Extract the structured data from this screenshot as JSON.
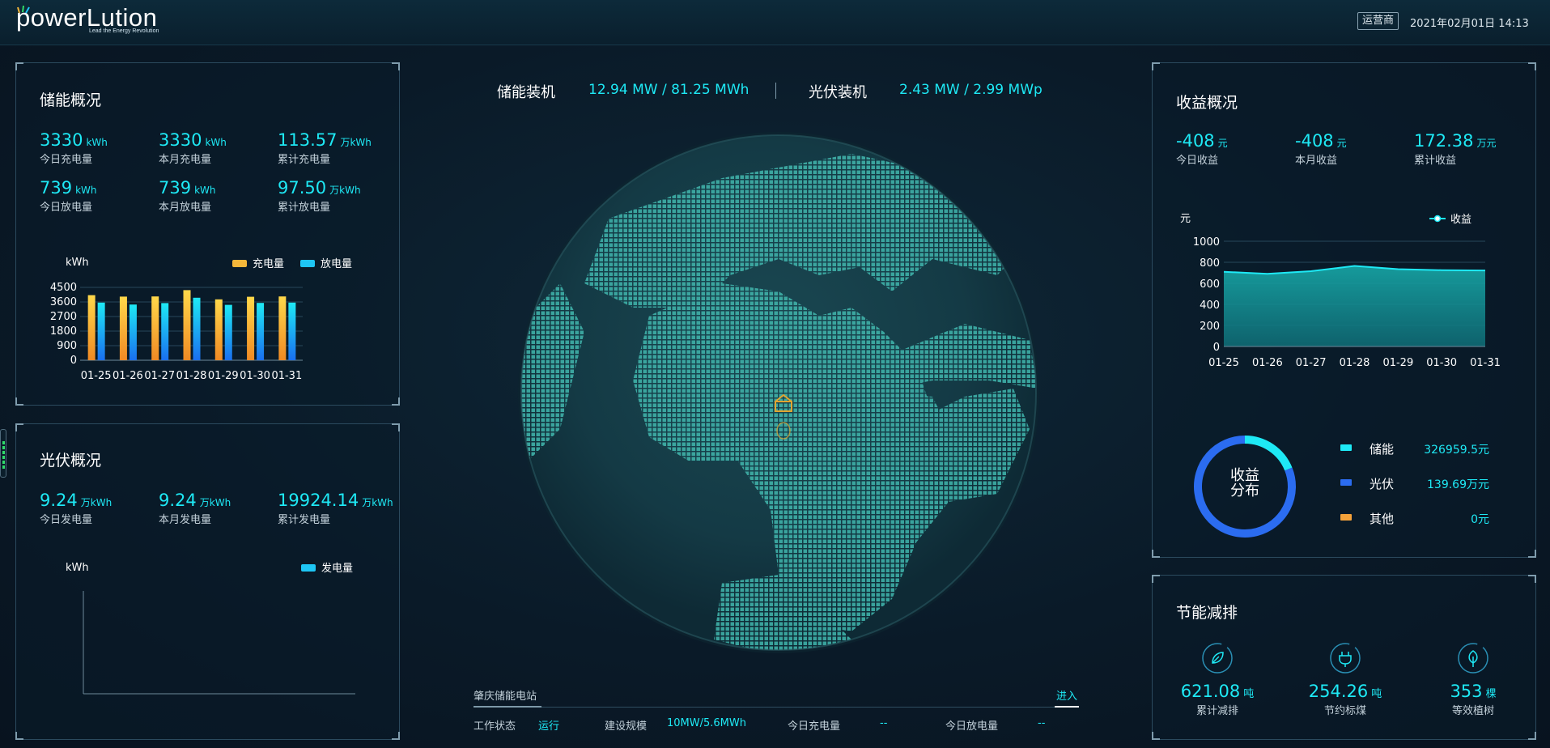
{
  "header": {
    "logo_text": "powerLution",
    "logo_tagline": "Lead the Energy Revolution",
    "role_badge": "运营商",
    "datetime": "2021年02月01日 14:13"
  },
  "storage_overview": {
    "title": "储能概况",
    "stats": [
      {
        "value": "3330",
        "unit": "kWh",
        "label": "今日充电量"
      },
      {
        "value": "3330",
        "unit": "kWh",
        "label": "本月充电量"
      },
      {
        "value": "113.57",
        "unit": "万kWh",
        "label": "累计充电量"
      },
      {
        "value": "739",
        "unit": "kWh",
        "label": "今日放电量"
      },
      {
        "value": "739",
        "unit": "kWh",
        "label": "本月放电量"
      },
      {
        "value": "97.50",
        "unit": "万kWh",
        "label": "累计放电量"
      }
    ]
  },
  "pv_overview": {
    "title": "光伏概况",
    "stats": [
      {
        "value": "9.24",
        "unit": "万kWh",
        "label": "今日发电量"
      },
      {
        "value": "9.24",
        "unit": "万kWh",
        "label": "本月发电量"
      },
      {
        "value": "19924.14",
        "unit": "万kWh",
        "label": "累计发电量"
      }
    ]
  },
  "center": {
    "storage_capacity_label": "储能装机",
    "storage_capacity_value": "12.94 MW / 81.25 MWh",
    "pv_capacity_label": "光伏装机",
    "pv_capacity_value": "2.43 MW / 2.99 MWp"
  },
  "station": {
    "name": "肇庆储能电站",
    "enter_label": "进入",
    "fields": [
      {
        "label": "工作状态",
        "value": "运行"
      },
      {
        "label": "建设规模",
        "value": "10MW/5.6MWh"
      },
      {
        "label": "今日充电量",
        "value": "--"
      },
      {
        "label": "今日放电量",
        "value": "--"
      }
    ]
  },
  "income_overview": {
    "title": "收益概况",
    "stats": [
      {
        "value": "-408",
        "unit": "元",
        "label": "今日收益"
      },
      {
        "value": "-408",
        "unit": "元",
        "label": "本月收益"
      },
      {
        "value": "172.38",
        "unit": "万元",
        "label": "累计收益"
      }
    ],
    "donut_label_line1": "收益",
    "donut_label_line2": "分布",
    "distribution": [
      {
        "name": "储能",
        "value": "326959.5元",
        "color": "#1ee9f5"
      },
      {
        "name": "光伏",
        "value": "139.69万元",
        "color": "#2b6cf0"
      },
      {
        "name": "其他",
        "value": "0元",
        "color": "#f5a23a"
      }
    ]
  },
  "energy_saving": {
    "title": "节能减排",
    "items": [
      {
        "icon": "leaf-icon",
        "value": "621.08",
        "unit": "吨",
        "label": "累计减排"
      },
      {
        "icon": "plug-icon",
        "value": "254.26",
        "unit": "吨",
        "label": "节约标煤"
      },
      {
        "icon": "tree-icon",
        "value": "353",
        "unit": "棵",
        "label": "等效植树"
      }
    ]
  },
  "chart_data": [
    {
      "type": "bar",
      "ylabel": "kWh",
      "categories": [
        "01-25",
        "01-26",
        "01-27",
        "01-28",
        "01-29",
        "01-30",
        "01-31"
      ],
      "y_ticks": [
        "0",
        "900",
        "1800",
        "2700",
        "3600",
        "4500"
      ],
      "ylim": [
        0,
        4500
      ],
      "legend_position": "top-right",
      "grid": true,
      "series": [
        {
          "name": "充电量",
          "color": "#f5b73a",
          "values": [
            4020,
            3930,
            3940,
            4330,
            3760,
            3920,
            3940
          ]
        },
        {
          "name": "放电量",
          "color": "#1ec6f5",
          "values": [
            3560,
            3440,
            3530,
            3860,
            3420,
            3540,
            3560
          ]
        }
      ]
    },
    {
      "type": "bar",
      "ylabel": "kWh",
      "categories": [],
      "legend_position": "top-right",
      "series": [
        {
          "name": "发电量",
          "color": "#1ec6f5",
          "values": []
        }
      ]
    },
    {
      "type": "area",
      "ylabel": "元",
      "categories": [
        "01-25",
        "01-26",
        "01-27",
        "01-28",
        "01-29",
        "01-30",
        "01-31"
      ],
      "y_ticks": [
        "0",
        "200",
        "400",
        "600",
        "800",
        "1000"
      ],
      "ylim": [
        0,
        1000
      ],
      "legend_position": "top-right",
      "grid": true,
      "series": [
        {
          "name": "收益",
          "color": "#1ee9f5",
          "values": [
            710,
            690,
            715,
            765,
            735,
            725,
            722
          ]
        }
      ]
    },
    {
      "type": "pie",
      "series": [
        {
          "name": "储能",
          "color": "#1ee9f5",
          "values": [
            326959.5
          ]
        },
        {
          "name": "光伏",
          "color": "#2b6cf0",
          "values": [
            1396900
          ]
        },
        {
          "name": "其他",
          "color": "#f5a23a",
          "values": [
            0
          ]
        }
      ]
    }
  ]
}
